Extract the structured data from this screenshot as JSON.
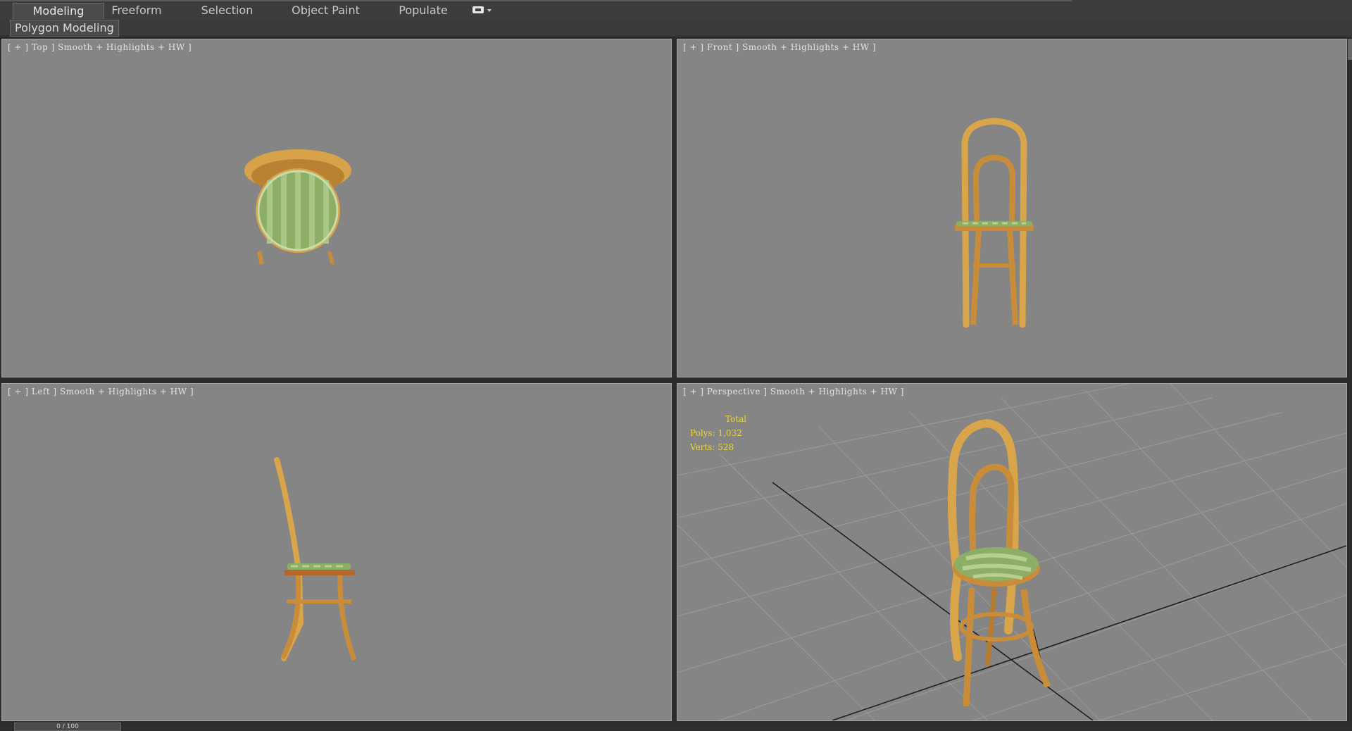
{
  "ribbon": {
    "tabs": [
      {
        "label": "Modeling",
        "active": true
      },
      {
        "label": "Freeform",
        "active": false
      },
      {
        "label": "Selection",
        "active": false
      },
      {
        "label": "Object Paint",
        "active": false
      },
      {
        "label": "Populate",
        "active": false
      }
    ],
    "extra_icon": "ribbon-options-icon"
  },
  "subtab": {
    "label": "Polygon Modeling"
  },
  "viewports": {
    "top": {
      "label": "[ + ] Top ] Smooth + Highlights + HW ]"
    },
    "front": {
      "label": "[ + ] Front ] Smooth + Highlights + HW ]"
    },
    "left": {
      "label": "[ + ] Left ] Smooth + Highlights + HW ]"
    },
    "perspective": {
      "label": "[ + ] Perspective ] Smooth + Highlights + HW ]"
    }
  },
  "stats": {
    "total": "Total",
    "polys": "Polys: 1,032",
    "verts": "Verts: 528"
  },
  "timeslider": {
    "label": "0 / 100"
  },
  "colors": {
    "viewport_bg": "#858585",
    "wood": "#d9a54a",
    "cushion": "#8db06a",
    "stats_text": "#e8d43c"
  }
}
